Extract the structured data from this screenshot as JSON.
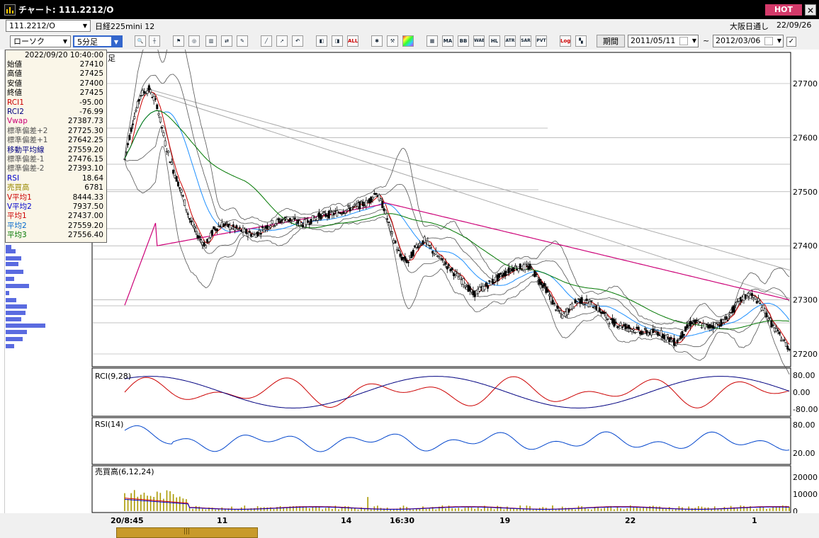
{
  "window": {
    "title": "チャート: 111.2212/O",
    "hot_label": "HOT",
    "close_label": "✕"
  },
  "toolbar1": {
    "symbol_value": "111.2212/O",
    "instrument_name": "日経225mini 12",
    "session_label": "大阪日通し",
    "date_right": "22/09/26"
  },
  "toolbar2": {
    "chart_type": "ローソク",
    "interval": "5分足",
    "period_button": "期間",
    "date_from": "2011/05/11",
    "date_to": "2012/03/06",
    "tilde": "~",
    "icons": [
      "zoom-icon",
      "crosshair-icon",
      "stamp-icon",
      "search-doc-icon",
      "chart-icon",
      "compare-icon",
      "memo-icon",
      "trendline-icon",
      "cursor-icon",
      "undo-icon",
      "candle-left-icon",
      "candle-right-icon",
      "all-icon",
      "tools-icon",
      "wrench-icon",
      "palette-icon",
      "ohlc-icon",
      "ma-icon",
      "bb-icon",
      "wae-icon",
      "hl-icon",
      "atr-icon",
      "sar-icon",
      "pvt-icon",
      "log-icon",
      "split-icon"
    ],
    "icon_texts": {
      "all": "ALL",
      "ma": "MA",
      "bb": "BB",
      "wae": "WAE",
      "hl": "HL",
      "atr": "ATR",
      "sar": "SAR",
      "pvt": "PVT",
      "log": "Log"
    }
  },
  "infobox": {
    "datetime": "2022/09/20  10:40:00",
    "rows": [
      {
        "label": "始値",
        "value": "27410",
        "color": "#000000"
      },
      {
        "label": "高値",
        "value": "27425",
        "color": "#000000"
      },
      {
        "label": "安値",
        "value": "27400",
        "color": "#000000"
      },
      {
        "label": "終値",
        "value": "27425",
        "color": "#000000"
      },
      {
        "label": "RCI1",
        "value": "-95.00",
        "color": "#cc0000"
      },
      {
        "label": "RCI2",
        "value": "-76.99",
        "color": "#000080"
      },
      {
        "label": "Vwap",
        "value": "27387.73",
        "color": "#cc0077"
      },
      {
        "label": "標準偏差+2",
        "value": "27725.30",
        "color": "#555555"
      },
      {
        "label": "標準偏差+1",
        "value": "27642.25",
        "color": "#555555"
      },
      {
        "label": "移動平均線",
        "value": "27559.20",
        "color": "#000080"
      },
      {
        "label": "標準偏差-1",
        "value": "27476.15",
        "color": "#555555"
      },
      {
        "label": "標準偏差-2",
        "value": "27393.10",
        "color": "#555555"
      },
      {
        "label": "RSI",
        "value": "18.64",
        "color": "#0000cc"
      },
      {
        "label": "売買高",
        "value": "6781",
        "color": "#998800"
      },
      {
        "label": "V平均1",
        "value": "8444.33",
        "color": "#cc0000"
      },
      {
        "label": "V平均2",
        "value": "7937.50",
        "color": "#0000cc"
      },
      {
        "label": "平均1",
        "value": "27437.00",
        "color": "#cc0000"
      },
      {
        "label": "平均2",
        "value": "27559.20",
        "color": "#0066cc"
      },
      {
        "label": "平均3",
        "value": "27556.40",
        "color": "#007700"
      }
    ]
  },
  "main_chart": {
    "partial_label": "足",
    "y_ticks": [
      "27700",
      "27600",
      "27500",
      "27400",
      "27300",
      "27200"
    ]
  },
  "rci_panel": {
    "label": "RCI(9,28)",
    "y_ticks": [
      "80.00",
      "0.00",
      "-80.00"
    ]
  },
  "rsi_panel": {
    "label": "RSI(14)",
    "y_ticks": [
      "80.00",
      "20.00"
    ]
  },
  "vol_panel": {
    "label": "売買高(6,12,24)",
    "y_ticks": [
      "20000",
      "10000",
      "0"
    ]
  },
  "x_axis": [
    "20/8:45",
    "11",
    "14",
    "16:30",
    "19",
    "22",
    "1"
  ],
  "scroll_label": "|||",
  "colors": {
    "rci1": "#cc0000",
    "rci2": "#000080",
    "rsi": "#0044cc",
    "vwap": "#cc0077",
    "ma_short": "#cc0000",
    "ma_mid": "#1e90ff",
    "ma_long": "#007700",
    "volume": "#aa9900"
  }
}
